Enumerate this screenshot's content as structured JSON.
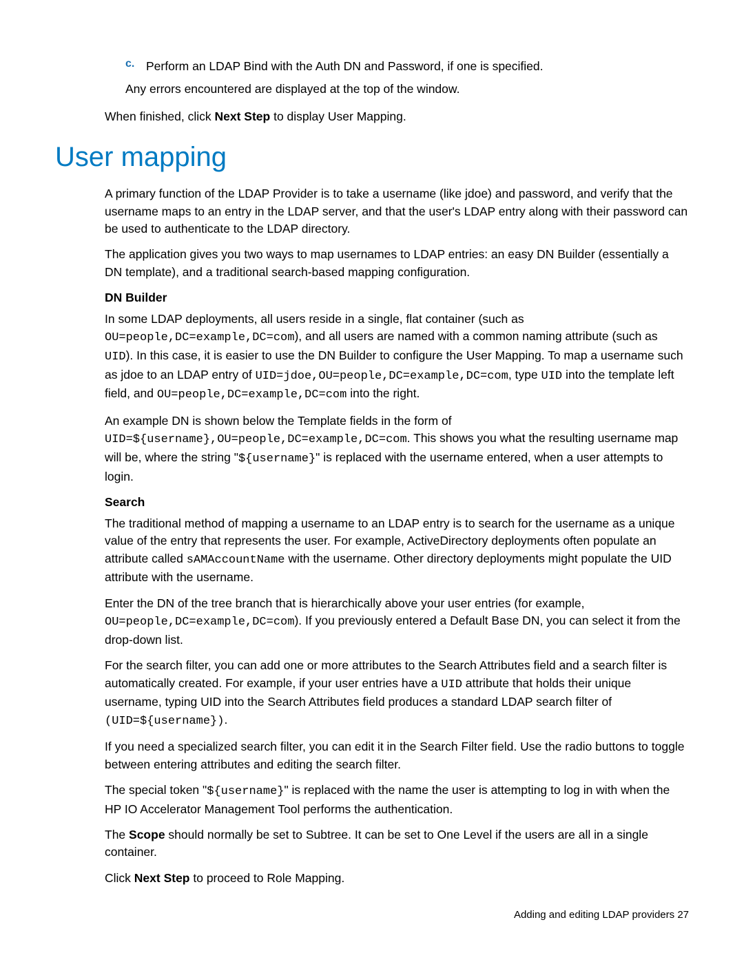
{
  "step_c": {
    "marker": "c.",
    "text": "Perform an LDAP Bind with the Auth DN and Password, if one is specified."
  },
  "errors_line": "Any errors encountered are displayed at the top of the window.",
  "finished_prefix": "When finished, click ",
  "finished_bold": "Next Step",
  "finished_suffix": " to display User Mapping.",
  "heading": "User mapping",
  "p1": "A primary function of the LDAP Provider is to take a username (like jdoe) and password, and verify that the username maps to an entry in the LDAP server, and that the user's LDAP entry along with their password can be used to authenticate to the LDAP directory.",
  "p2": "The application gives you two ways to map usernames to LDAP entries: an easy DN Builder (essentially a DN template), and a traditional search-based mapping configuration.",
  "dn_builder_head": "DN Builder",
  "dn1_a": "In some LDAP deployments, all users reside in a single, flat container (such as ",
  "dn1_code1": "OU=people,DC=example,DC=com",
  "dn1_b": "), and all users are named with a common naming attribute (such as ",
  "dn1_code2": "UID",
  "dn1_c": "). In this case, it is easier to use the DN Builder to configure the User Mapping. To map a username such as jdoe to an LDAP entry of ",
  "dn1_code3": "UID=jdoe,OU=people,DC=example,DC=com",
  "dn1_d": ", type ",
  "dn1_code4": "UID",
  "dn1_e": " into the template left field, and ",
  "dn1_code5": "OU=people,DC=example,DC=com",
  "dn1_f": " into the right.",
  "dn2_a": "An example DN is shown below the Template fields in the form of ",
  "dn2_code1": "UID=${username},OU=people,DC=example,DC=com",
  "dn2_b": ". This shows you what the resulting username map will be, where the string \"",
  "dn2_code2": "${username}",
  "dn2_c": "\" is replaced with the username entered, when a user attempts to login.",
  "search_head": "Search",
  "s1_a": "The traditional method of mapping a username to an LDAP entry is to search for the username as a unique value of the entry that represents the user. For example, ActiveDirectory deployments often populate an attribute called ",
  "s1_code1": "sAMAccountName",
  "s1_b": " with the username. Other directory deployments might populate the UID attribute with the username.",
  "s2_a": "Enter the DN of the tree branch that is hierarchically above your user entries (for example, ",
  "s2_code1": "OU=people,DC=example,DC=com",
  "s2_b": "). If you previously entered a Default Base DN, you can select it from the drop-down list.",
  "s3_a": "For the search filter, you can add one or more attributes to the Search Attributes field and a search filter is automatically created. For example, if your user entries have a ",
  "s3_code1": "UID",
  "s3_b": " attribute that holds their unique username, typing UID into the Search Attributes field   produces a standard LDAP search filter of ",
  "s3_code2": "(UID=${username})",
  "s3_c": ".",
  "s4": "If you need a specialized search filter, you can edit it in the Search Filter field. Use the radio buttons to toggle between entering attributes and editing the search filter.",
  "s5_a": "The special token \"",
  "s5_code1": "${username}",
  "s5_b": "\" is replaced with the name the user is attempting to log in with when the HP IO Accelerator Management Tool performs the authentication.",
  "s6_a": "The ",
  "s6_bold": "Scope",
  "s6_b": " should normally be set to Subtree. It can be set to One Level if the users are all in a single container.",
  "s7_a": "Click ",
  "s7_bold": "Next Step",
  "s7_b": " to proceed to Role Mapping.",
  "footer_text": "Adding and editing LDAP providers   27"
}
